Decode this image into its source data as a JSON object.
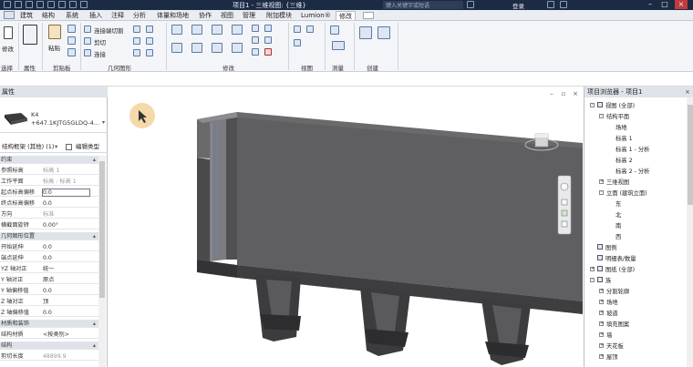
{
  "app": {
    "title": "项目1 - 三维视图: {三维}",
    "search_placeholder": "键入关键字或短语",
    "login_label": "登录"
  },
  "ribbon_tabs": [
    "建筑",
    "结构",
    "系统",
    "插入",
    "注释",
    "分析",
    "体量和场地",
    "协作",
    "视图",
    "管理",
    "附加模块",
    "Lumion®",
    "修改"
  ],
  "ribbon": {
    "modify_label": "修改",
    "select_group": "选择",
    "properties_group": "属性",
    "clipboard_group": "剪贴板",
    "paste_label": "粘贴",
    "geometry_group": "几何图形",
    "connect_cut": "连接端切割",
    "cut_label": "剪切",
    "join_label": "连接",
    "modify_group": "修改",
    "view_group": "视图",
    "measure_group": "测量",
    "create_group": "创建"
  },
  "properties": {
    "header": "属性",
    "type_name": "K4",
    "type_sub": "+647.1KJTG5GLDQ-4...",
    "filter_label": "结构框架 (其他) (1)",
    "edit_type_label": "编辑类型",
    "rows": [
      {
        "k": "约束",
        "v": "",
        "group": true
      },
      {
        "k": "参照标高",
        "v": "标高 1",
        "dim": true
      },
      {
        "k": "工作平面",
        "v": "标高 : 标高 1",
        "dim": true
      },
      {
        "k": "起点标高偏移",
        "v": "0.0",
        "box": true
      },
      {
        "k": "终点标高偏移",
        "v": "0.0"
      },
      {
        "k": "方向",
        "v": "标准",
        "dim": true
      },
      {
        "k": "横截面旋转",
        "v": "0.00°"
      },
      {
        "k": "几何图形位置",
        "v": "",
        "group": true
      },
      {
        "k": "开始延伸",
        "v": "0.0"
      },
      {
        "k": "端点延伸",
        "v": "0.0"
      },
      {
        "k": "YZ 轴对正",
        "v": "统一"
      },
      {
        "k": "Y 轴对正",
        "v": "原点"
      },
      {
        "k": "Y 轴偏移值",
        "v": "0.0"
      },
      {
        "k": "Z 轴对正",
        "v": "顶"
      },
      {
        "k": "Z 轴偏移值",
        "v": "0.0"
      },
      {
        "k": "材质和装饰",
        "v": "",
        "group": true
      },
      {
        "k": "结构材质",
        "v": "<按类别>"
      },
      {
        "k": "结构",
        "v": "",
        "group": true
      },
      {
        "k": "剪切长度",
        "v": "48899.9",
        "dim": true
      }
    ]
  },
  "browser": {
    "header": "项目浏览器 - 项目1",
    "items": [
      {
        "label": "视图 (全部)",
        "level": 0,
        "toggle": "-",
        "icon": true
      },
      {
        "label": "结构平面",
        "level": 1,
        "toggle": "-"
      },
      {
        "label": "场地",
        "level": 2
      },
      {
        "label": "标高 1",
        "level": 2
      },
      {
        "label": "标高 1 - 分析",
        "level": 2
      },
      {
        "label": "标高 2",
        "level": 2
      },
      {
        "label": "标高 2 - 分析",
        "level": 2
      },
      {
        "label": "三维视图",
        "level": 1,
        "toggle": "+"
      },
      {
        "label": "立面 (建筑立面)",
        "level": 1,
        "toggle": "-"
      },
      {
        "label": "东",
        "level": 2
      },
      {
        "label": "北",
        "level": 2
      },
      {
        "label": "南",
        "level": 2
      },
      {
        "label": "西",
        "level": 2
      },
      {
        "label": "图例",
        "level": 0,
        "icon": true
      },
      {
        "label": "明细表/数量",
        "level": 0,
        "icon": true
      },
      {
        "label": "图纸 (全部)",
        "level": 0,
        "toggle": "+",
        "icon": true
      },
      {
        "label": "族",
        "level": 0,
        "toggle": "-",
        "icon": true
      },
      {
        "label": "分割轮廓",
        "level": 1,
        "toggle": "+"
      },
      {
        "label": "场地",
        "level": 1,
        "toggle": "+"
      },
      {
        "label": "坡道",
        "level": 1,
        "toggle": "+"
      },
      {
        "label": "填充图案",
        "level": 1,
        "toggle": "+"
      },
      {
        "label": "墙",
        "level": 1,
        "toggle": "+"
      },
      {
        "label": "天花板",
        "level": 1,
        "toggle": "+"
      },
      {
        "label": "屋顶",
        "level": 1,
        "toggle": "+"
      }
    ]
  },
  "colors": {
    "title_bar": "#1c2b44",
    "model_top": "#5f5f62",
    "model_side": "#3f3f42",
    "cursor_highlight": "#f6d9a8"
  }
}
